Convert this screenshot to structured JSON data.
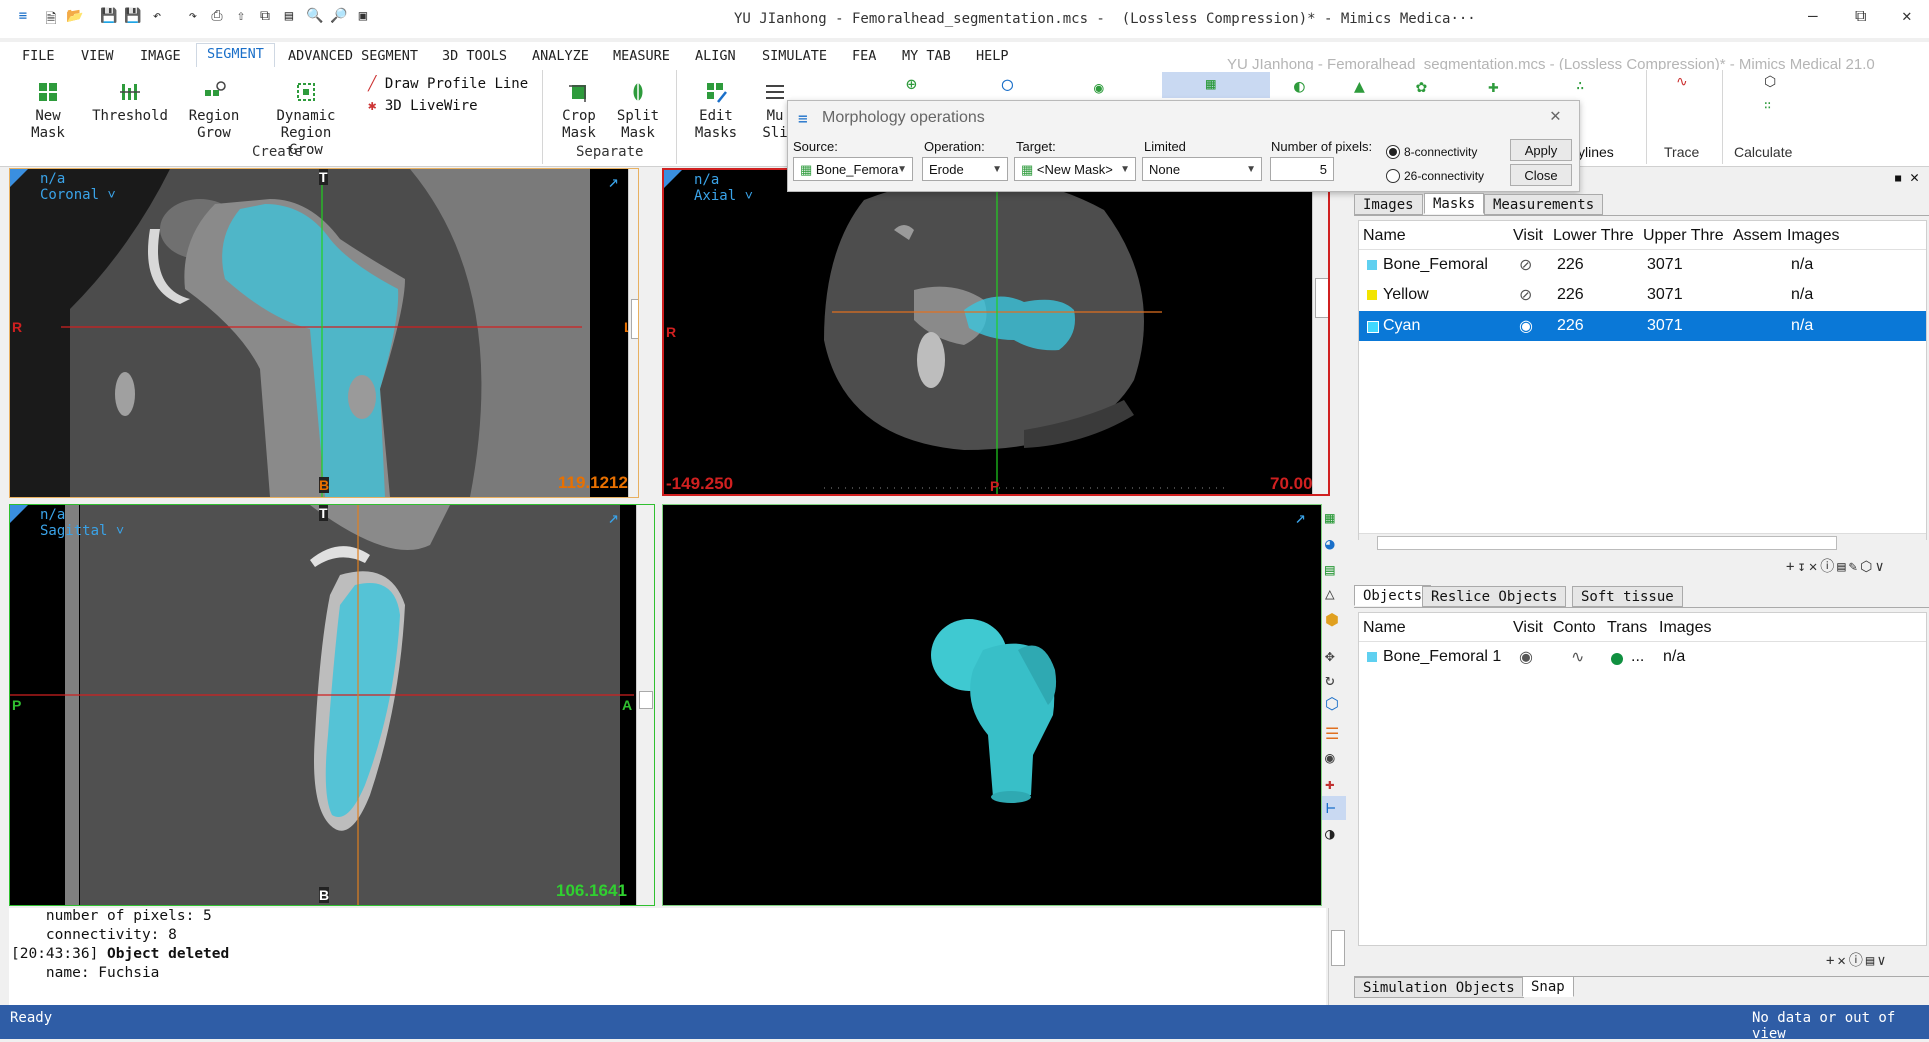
{
  "window": {
    "title": "YU JIanhong - Femoralhead_segmentation.mcs -  (Lossless Compression)* - Mimics Medica···",
    "ghost_title": "YU JIanhong - Femoralhead_segmentation.mcs - (Lossless Compression)* - Mimics Medical 21.0",
    "minimize": "–",
    "restore": "⧉",
    "close": "✕"
  },
  "menu": [
    "FILE",
    "VIEW",
    "IMAGE",
    "SEGMENT",
    "ADVANCED SEGMENT",
    "3D TOOLS",
    "ANALYZE",
    "MEASURE",
    "ALIGN",
    "SIMULATE",
    "FEA",
    "MY TAB",
    "HELP"
  ],
  "ribbon": {
    "new_mask": [
      "New",
      "Mask"
    ],
    "threshold": "Threshold",
    "region_grow": [
      "Region",
      "Grow"
    ],
    "dynamic_region_grow": [
      "Dynamic Region",
      "Grow"
    ],
    "draw_profile_line": "Draw Profile Line",
    "livewire": "3D LiveWire",
    "create_group": "Create",
    "crop_mask": [
      "Crop",
      "Mask"
    ],
    "split_mask": [
      "Split",
      "Mask"
    ],
    "separate_group": "Separate",
    "edit_masks": [
      "Edit",
      "Masks"
    ],
    "multi_slice": [
      "Mu",
      "Sli"
    ],
    "polylines_partial": "ylines",
    "trace": "Trace",
    "calculate": "Calculate"
  },
  "dialog": {
    "title": "Morphology operations",
    "source_label": "Source:",
    "source_value": "Bone_Femora",
    "operation_label": "Operation:",
    "operation_value": "Erode",
    "target_label": "Target:",
    "target_value": "<New Mask>",
    "limited_label": "Limited",
    "limited_value": "None",
    "pixels_label": "Number of pixels:",
    "pixels_value": "5",
    "conn8": "8-connectivity",
    "conn26": "26-connectivity",
    "apply": "Apply",
    "close": "Close"
  },
  "viewports": {
    "coronal": {
      "na": "n/a",
      "name": "Coronal ˅",
      "value": "119.1212",
      "top": "T",
      "bottom": "B",
      "left": "R",
      "right": "L"
    },
    "axial": {
      "na": "n/a",
      "name": "Axial ˅",
      "value": "70.000",
      "left_value": "-149.250",
      "bottom": "P",
      "left": "R",
      "right": "L"
    },
    "sagittal": {
      "na": "n/a",
      "name": "Sagittal ˅",
      "value": "106.1641",
      "top": "T",
      "bottom": "B",
      "left": "P",
      "right": "A"
    }
  },
  "masks_panel": {
    "tabs": [
      "Images",
      "Masks",
      "Measurements"
    ],
    "columns": [
      "Name",
      "Visit",
      "Lower Thre",
      "Upper Thre",
      "Assem",
      "Images"
    ],
    "rows": [
      {
        "name": "Bone_Femoral",
        "color": "#5fd0f0",
        "lower": "226",
        "upper": "3071",
        "images": "n/a"
      },
      {
        "name": "Yellow",
        "color": "#f2e400",
        "lower": "226",
        "upper": "3071",
        "images": "n/a"
      },
      {
        "name": "Cyan",
        "color": "#40d8ff",
        "lower": "226",
        "upper": "3071",
        "images": "n/a"
      }
    ]
  },
  "objects_panel": {
    "tabs": [
      "Objects",
      "Reslice Objects",
      "Soft tissue"
    ],
    "columns": [
      "Name",
      "Visit",
      "Conto",
      "Trans",
      "Images"
    ],
    "rows": [
      {
        "name": "Bone_Femoral 1",
        "color": "#5fd0f0",
        "trans": "...",
        "images": "n/a"
      }
    ]
  },
  "bottom_tabs": [
    "Simulation Objects",
    "Snap"
  ],
  "log": [
    "    number of pixels: 5",
    "    connectivity: 8",
    "[20:43:36] ",
    "    name: Fuchsia"
  ],
  "log_bold": "Object deleted",
  "status": {
    "left": "Ready",
    "right": "No data or out of view"
  },
  "colors": {
    "accent": "#1a6fc9",
    "mask_cyan": "#3bc4dc",
    "status_bar": "#2f5da6",
    "selected_row": "#0a78d7"
  }
}
